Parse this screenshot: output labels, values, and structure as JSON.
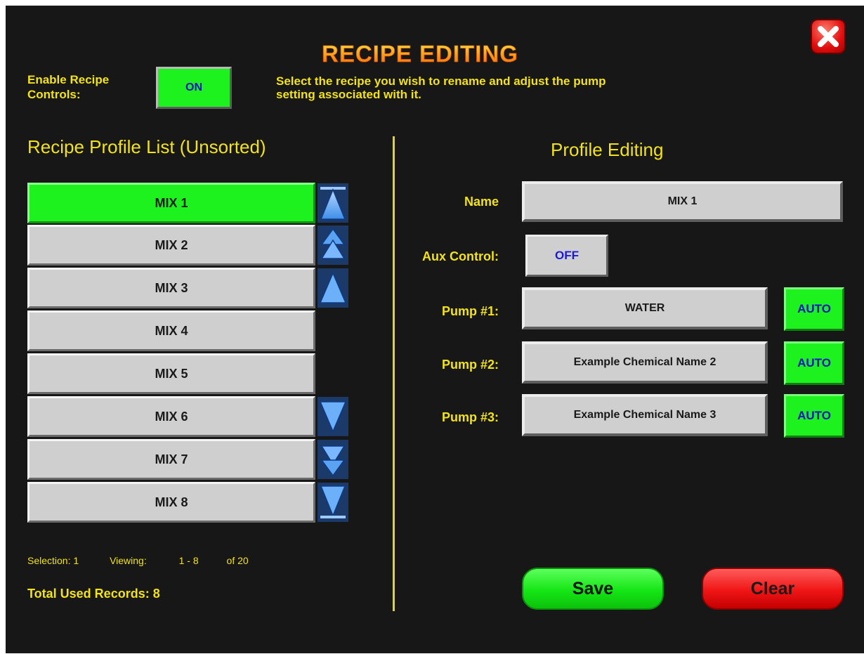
{
  "title": "RECIPE EDITING",
  "enable_controls": {
    "label": "Enable Recipe Controls:",
    "state": "ON"
  },
  "instruction": "Select the recipe you wish to rename and adjust the pump setting associated with it.",
  "recipe_list": {
    "header": "Recipe Profile List (Unsorted)",
    "items": [
      "MIX 1",
      "MIX 2",
      "MIX 3",
      "MIX 4",
      "MIX 5",
      "MIX 6",
      "MIX 7",
      "MIX 8"
    ],
    "selected_index": 0,
    "selection_label": "Selection: 1",
    "viewing_label": "Viewing:",
    "viewing_range": "1 - 8",
    "of_total": "of 20",
    "total_used_label": "Total Used Records:",
    "total_used_value": "8"
  },
  "profile_editing": {
    "header": "Profile Editing",
    "name_label": "Name",
    "name_value": "MIX 1",
    "aux_label": "Aux Control:",
    "aux_value": "OFF",
    "pumps": [
      {
        "label": "Pump #1:",
        "value": "WATER",
        "mode": "AUTO"
      },
      {
        "label": "Pump #2:",
        "value": "Example Chemical Name 2",
        "mode": "AUTO"
      },
      {
        "label": "Pump #3:",
        "value": "Example Chemical Name 3",
        "mode": "AUTO"
      }
    ]
  },
  "buttons": {
    "save": "Save",
    "clear": "Clear"
  },
  "colors": {
    "background": "#171717",
    "label_yellow": "#f2e21a",
    "active_green": "#1ef21e",
    "clear_red": "#f01515",
    "toggle_text_blue": "#1111c8"
  },
  "icons": {
    "close": "close-x-icon",
    "scroll_top": "scroll-to-top-icon",
    "page_up": "page-up-icon",
    "line_up": "line-up-icon",
    "line_down": "line-down-icon",
    "page_down": "page-down-icon",
    "scroll_bottom": "scroll-to-bottom-icon"
  }
}
